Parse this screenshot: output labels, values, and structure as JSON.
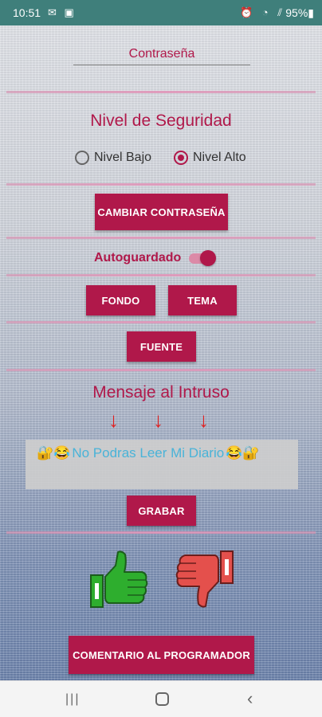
{
  "status_bar": {
    "time": "10:51",
    "left_icons": "✉ ▣",
    "right_icons": "⏰ ◔ ⫽",
    "battery": "95%▮"
  },
  "password": {
    "placeholder": "Contraseña",
    "value": ""
  },
  "security": {
    "title": "Nivel de Seguridad",
    "options": [
      {
        "label": "Nivel Bajo",
        "selected": false
      },
      {
        "label": "Nivel Alto",
        "selected": true
      }
    ]
  },
  "buttons": {
    "change_password": "CAMBIAR CONTRASEÑA",
    "background": "FONDO",
    "theme": "TEMA",
    "font": "FUENTE",
    "save": "GRABAR",
    "comment": "COMENTARIO AL PROGRAMADOR"
  },
  "autosave": {
    "label": "Autoguardado",
    "enabled": true
  },
  "intruder": {
    "title": "Mensaje al Intruso",
    "arrows": [
      "↓",
      "↓",
      "↓"
    ],
    "message": {
      "emoji_left": "🔐😂",
      "text": "No Podras Leer Mi Diario",
      "emoji_right": "😂🔐"
    }
  },
  "feedback": {
    "like_icon": "thumbs-up-icon",
    "dislike_icon": "thumbs-down-icon"
  },
  "nav": {
    "recents": "|||",
    "back": "‹"
  },
  "colors": {
    "accent": "#b0184a",
    "status_bar": "#3f7f7b",
    "message_text": "#49b3d8",
    "thumb_up": "#2eae2e",
    "thumb_down": "#e4504c"
  }
}
